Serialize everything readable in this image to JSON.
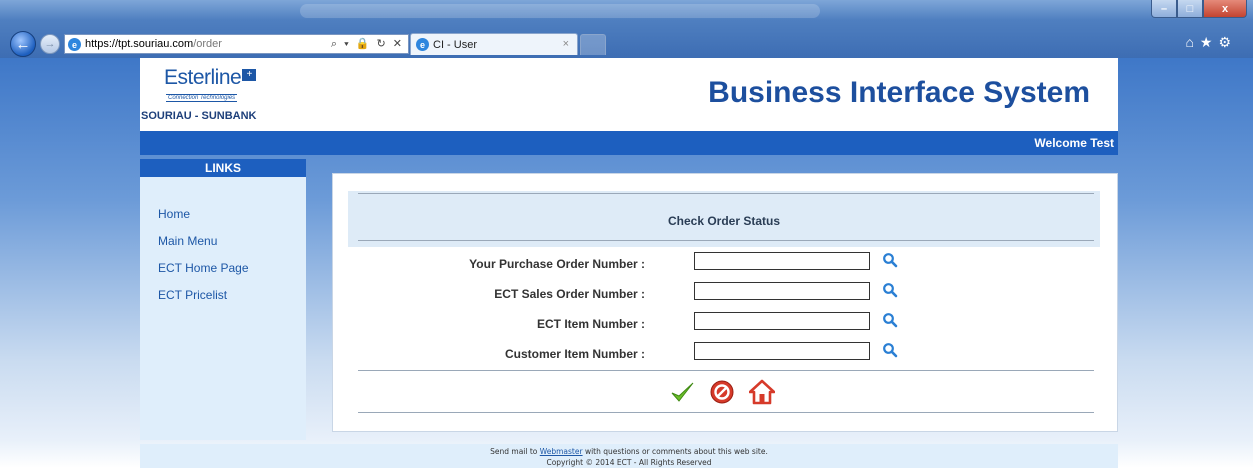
{
  "browser": {
    "url_host": "https://tpt.souriau.com",
    "url_path": "/order",
    "address_tools": "⌕ ▾ 🔒 ↻ ✕",
    "tab_title": "CI - User",
    "tab_close": "×",
    "window_buttons": [
      "–",
      "□",
      "x"
    ],
    "right_icons": "⌂★⚙"
  },
  "header": {
    "brand": "Esterline",
    "brand_tagline": "Connection Technologies",
    "sub_brand": "SOURIAU - SUNBANK",
    "system_title": "Business Interface System",
    "welcome": "Welcome Test"
  },
  "sidebar": {
    "title": "LINKS",
    "items": [
      {
        "label": "Home"
      },
      {
        "label": "Main Menu"
      },
      {
        "label": "ECT Home Page"
      },
      {
        "label": "ECT Pricelist"
      }
    ]
  },
  "form": {
    "title": "Check Order Status",
    "fields": [
      {
        "label": "Your Purchase Order Number :",
        "value": ""
      },
      {
        "label": "ECT Sales Order Number :",
        "value": ""
      },
      {
        "label": "ECT Item Number :",
        "value": ""
      },
      {
        "label": "Customer Item Number :",
        "value": ""
      }
    ]
  },
  "footer": {
    "text_before": "Send mail to ",
    "link": "Webmaster",
    "text_after": " with questions or comments about this web site.",
    "copyright": "Copyright © 2014 ECT - All Rights Reserved"
  },
  "colors": {
    "header_bar": "#1d5fbf",
    "title": "#1d4f9e",
    "sidebar_bg": "#dfeefb",
    "panel_bg": "#deebf7"
  }
}
